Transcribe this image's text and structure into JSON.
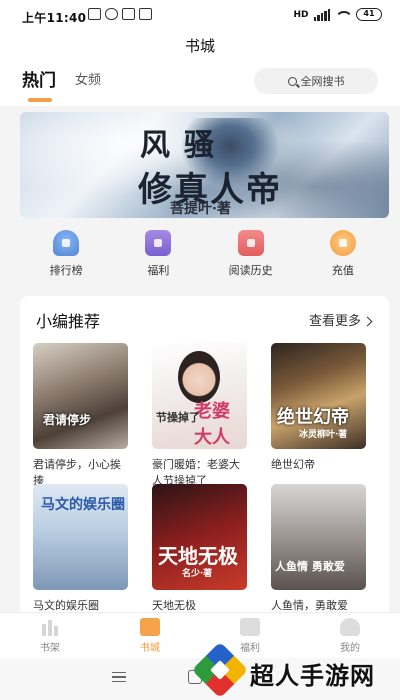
{
  "status_bar": {
    "time": "上午11:40",
    "battery": "41",
    "icons": [
      "message-icon",
      "cloud-icon",
      "mail-icon",
      "missed-call-icon",
      "hd-icon",
      "signal-icon",
      "wifi-icon",
      "battery-icon"
    ]
  },
  "header": {
    "title": "书城"
  },
  "tabs": [
    {
      "label": "热门",
      "active": true
    },
    {
      "label": "女频",
      "active": false
    }
  ],
  "search": {
    "placeholder": "全网搜书"
  },
  "banner": {
    "title_top": "风骚",
    "title_main": "修真人帝",
    "author": "菩提叶·著"
  },
  "quick_links": [
    {
      "label": "排行榜",
      "icon": "trophy-icon"
    },
    {
      "label": "福利",
      "icon": "gift-box-icon"
    },
    {
      "label": "阅读历史",
      "icon": "history-book-icon"
    },
    {
      "label": "充值",
      "icon": "coin-icon"
    }
  ],
  "recommend": {
    "title": "小编推荐",
    "more": "查看更多",
    "books": [
      {
        "name": "君请停步，小心挨揍",
        "cover_text": "君请停步"
      },
      {
        "name": "豪门暖婚：老婆大人节操掉了",
        "cover_text": "老婆大人",
        "cover_sub": "节操掉了"
      },
      {
        "name": "绝世幻帝",
        "cover_text": "绝世幻帝",
        "cover_sub": "冰灵柳叶·著"
      },
      {
        "name": "马文的娱乐圈",
        "cover_text": "马文的娱乐圈"
      },
      {
        "name": "天地无极",
        "cover_text": "天地无极",
        "cover_sub": "名少·著"
      },
      {
        "name": "人鱼情，勇敢爱",
        "cover_text": "人鱼情 勇敢爱"
      }
    ]
  },
  "bottom_nav": [
    {
      "label": "书架",
      "active": false
    },
    {
      "label": "书城",
      "active": true
    },
    {
      "label": "福利",
      "active": false
    },
    {
      "label": "我的",
      "active": false
    }
  ],
  "watermark": {
    "text": "超人手游网"
  },
  "colors": {
    "accent": "#f39a39"
  }
}
